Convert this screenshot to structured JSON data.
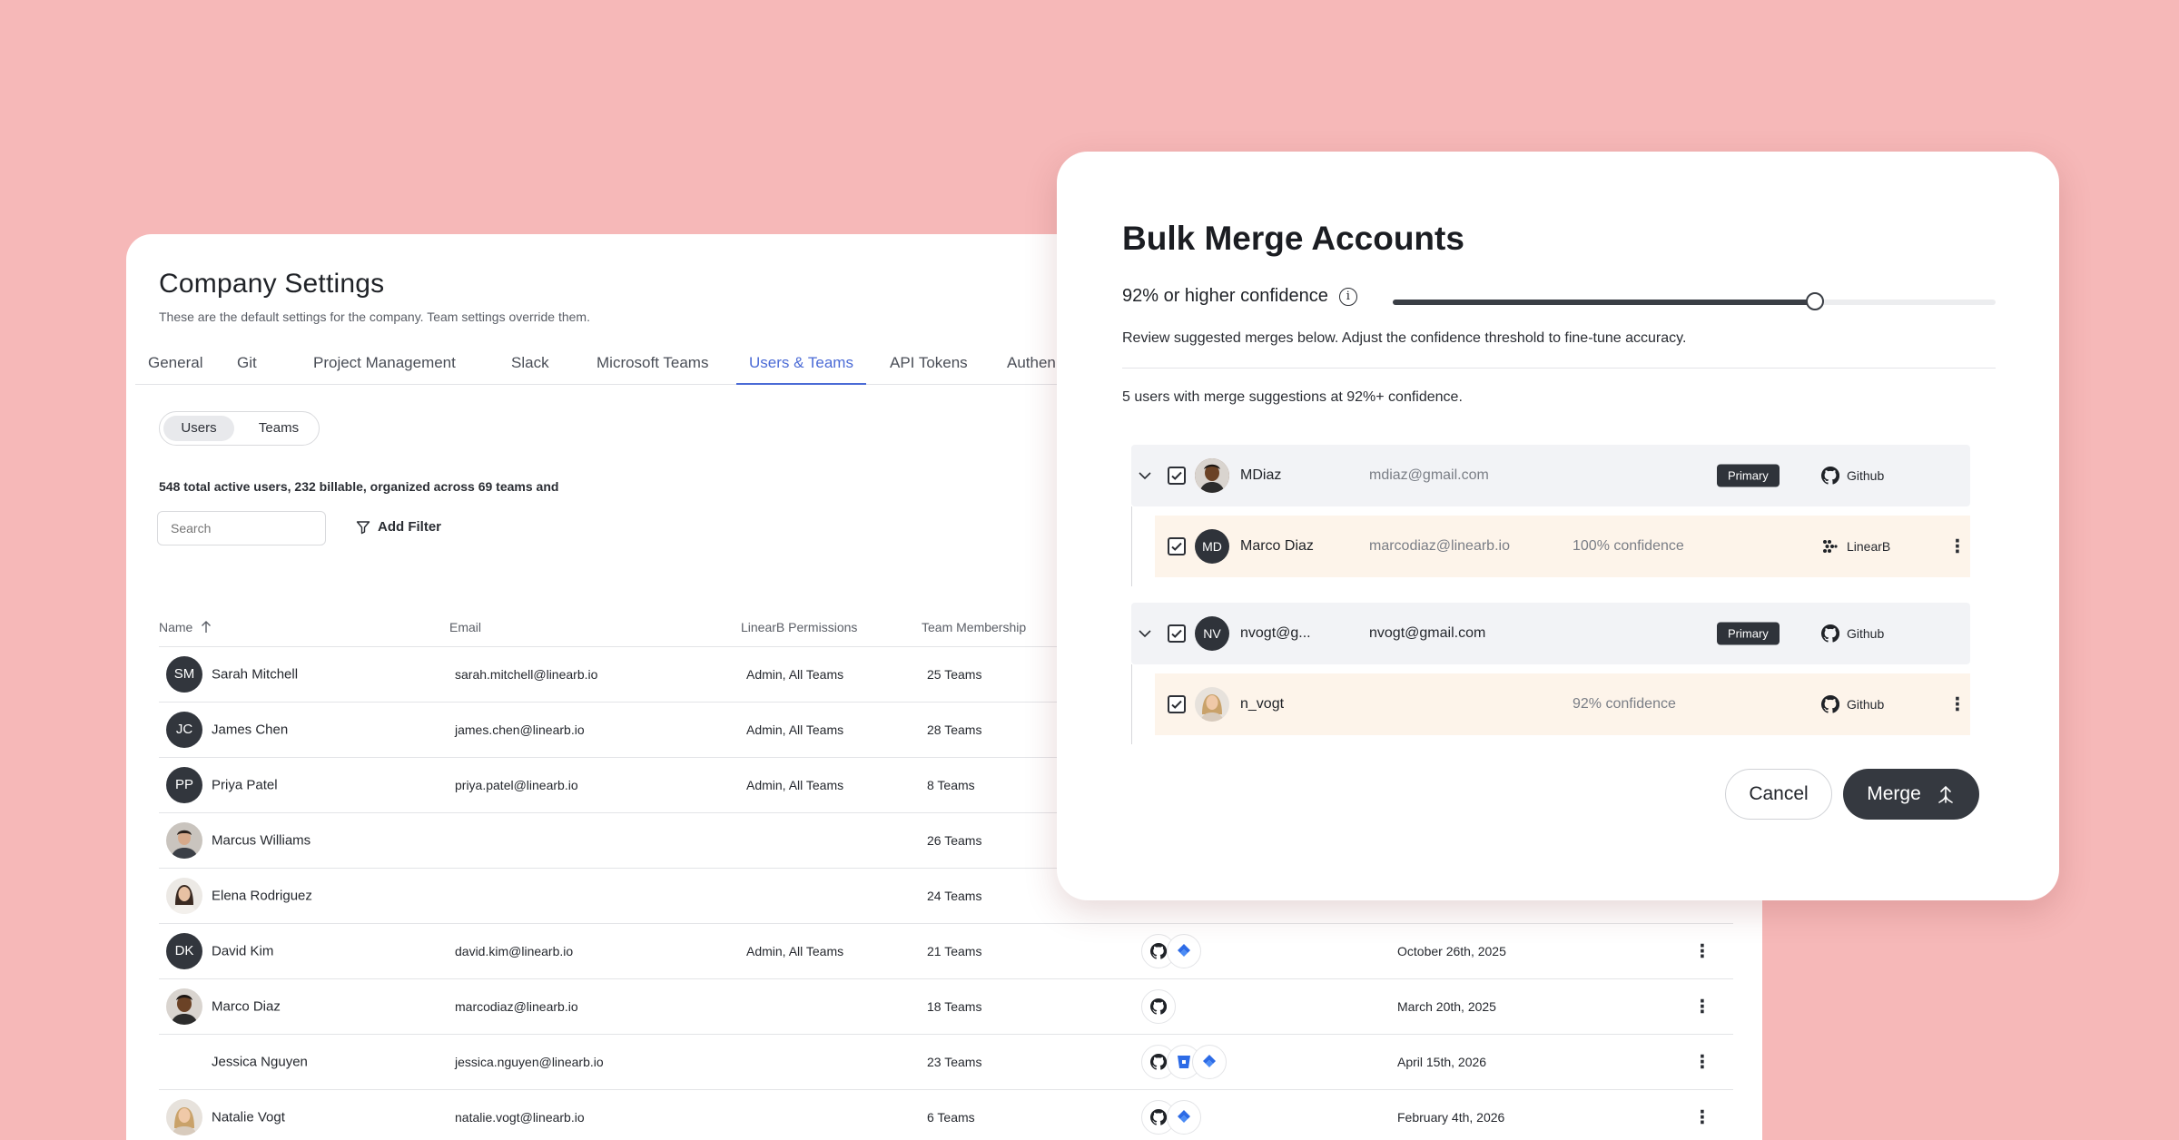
{
  "settings": {
    "title": "Company Settings",
    "subtitle": "These are the default settings for the company. Team settings override them.",
    "tabs": [
      "General",
      "Git",
      "Project Management",
      "Slack",
      "Microsoft Teams",
      "Users & Teams",
      "API Tokens",
      "Authen"
    ],
    "active_tab": "Users & Teams",
    "segment": {
      "users": "Users",
      "teams": "Teams"
    },
    "summary": "548 total active users, 232 billable, organized across 69 teams and",
    "search_placeholder": "Search",
    "add_filter": "Add Filter",
    "columns": {
      "name": "Name",
      "email": "Email",
      "permissions": "LinearB Permissions",
      "teams": "Team Membership"
    },
    "rows": [
      {
        "initials": "SM",
        "name": "Sarah Mitchell",
        "email": "sarah.mitchell@linearb.io",
        "permissions": "Admin, All Teams",
        "teams": "25 Teams",
        "date": "",
        "integrations": []
      },
      {
        "initials": "JC",
        "name": "James Chen",
        "email": "james.chen@linearb.io",
        "permissions": "Admin, All Teams",
        "teams": "28 Teams",
        "date": "",
        "integrations": []
      },
      {
        "initials": "PP",
        "name": "Priya Patel",
        "email": "priya.patel@linearb.io",
        "permissions": "Admin, All Teams",
        "teams": "8 Teams",
        "date": "",
        "integrations": []
      },
      {
        "initials": "",
        "photo": "man-dark-hair",
        "name": "Marcus Williams",
        "email": "",
        "permissions": "",
        "teams": "26 Teams",
        "date": "",
        "integrations": []
      },
      {
        "initials": "",
        "photo": "woman-dark-hair",
        "name": "Elena Rodriguez",
        "email": "",
        "permissions": "",
        "teams": "24 Teams",
        "date": "",
        "integrations": []
      },
      {
        "initials": "DK",
        "name": "David Kim",
        "email": "david.kim@linearb.io",
        "permissions": "Admin, All Teams",
        "teams": "21 Teams",
        "date": "October 26th, 2025",
        "integrations": [
          "github",
          "jira"
        ]
      },
      {
        "initials": "",
        "photo": "man-curly-hair",
        "name": "Marco Diaz",
        "email": "marcodiaz@linearb.io",
        "permissions": "",
        "teams": "18 Teams",
        "date": "March 20th, 2025",
        "integrations": [
          "github"
        ]
      },
      {
        "initials": "",
        "name": "Jessica Nguyen",
        "email": "jessica.nguyen@linearb.io",
        "permissions": "",
        "teams": "23 Teams",
        "date": "April 15th, 2026",
        "integrations": [
          "github",
          "bitbucket",
          "jira"
        ]
      },
      {
        "initials": "",
        "photo": "woman-blonde-hair",
        "name": "Natalie Vogt",
        "email": "natalie.vogt@linearb.io",
        "permissions": "",
        "teams": "6 Teams",
        "date": "February 4th, 2026",
        "integrations": [
          "github",
          "jira"
        ]
      }
    ]
  },
  "modal": {
    "title": "Bulk Merge Accounts",
    "confidence_label": "92% or higher confidence",
    "confidence_value": 0.92,
    "info_glyph": "i",
    "review_text": "Review suggested merges below. Adjust the confidence threshold to fine-tune accuracy.",
    "count_text": "5 users with merge suggestions at 92%+ confidence.",
    "groups": [
      {
        "primary": {
          "name": "MDiaz",
          "email": "mdiaz@gmail.com",
          "badge": "Primary",
          "source": "Github"
        },
        "child": {
          "initials": "MD",
          "name": "Marco Diaz",
          "email": "marcodiaz@linearb.io",
          "confidence": "100% confidence",
          "source": "LinearB"
        }
      },
      {
        "primary": {
          "initials": "NV",
          "name": "nvogt@g...",
          "email": "nvogt@gmail.com",
          "badge": "Primary",
          "source": "Github"
        },
        "child": {
          "name": "n_vogt",
          "email": "",
          "confidence": "92% confidence",
          "source": "Github"
        }
      }
    ],
    "cancel_label": "Cancel",
    "merge_label": "Merge"
  },
  "colors": {
    "background": "#f6b8b8",
    "accent": "#4b6bd6",
    "dark": "#32363d",
    "child_row": "#fdf4ea"
  }
}
